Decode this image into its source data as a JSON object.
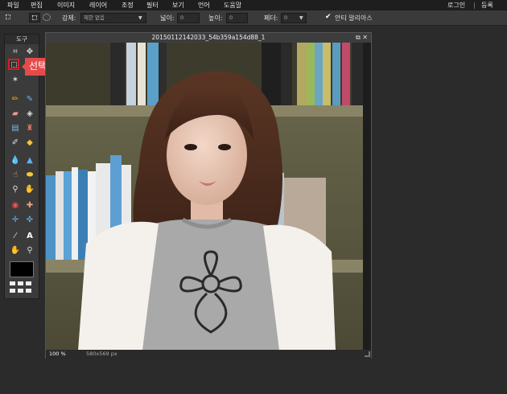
{
  "menu": {
    "items": [
      "파일",
      "편집",
      "이미지",
      "레이어",
      "조정",
      "필터",
      "보기",
      "언어",
      "도움말"
    ],
    "login": "로그인",
    "separator": "|",
    "register": "등록"
  },
  "options": {
    "strength_label": "강제:",
    "strength_value": "제한 없음",
    "width_label": "넓이:",
    "width_value": "0",
    "height_label": "높이:",
    "height_value": "0",
    "feather_label": "페더:",
    "feather_value": "0",
    "antialias_label": "안티 알리아스",
    "antialias_checked": true
  },
  "toolbox": {
    "title": "도구",
    "foreground_color": "#000000"
  },
  "tooltip": {
    "text": "선택 도구"
  },
  "document": {
    "title": "20150112142033_54b359a154d88_1",
    "zoom": "100",
    "zoom_unit": "%",
    "dimensions": "580x569 px"
  },
  "colors": {
    "accent": "#d21f24",
    "tooltip_bg": "#e54b4b"
  }
}
